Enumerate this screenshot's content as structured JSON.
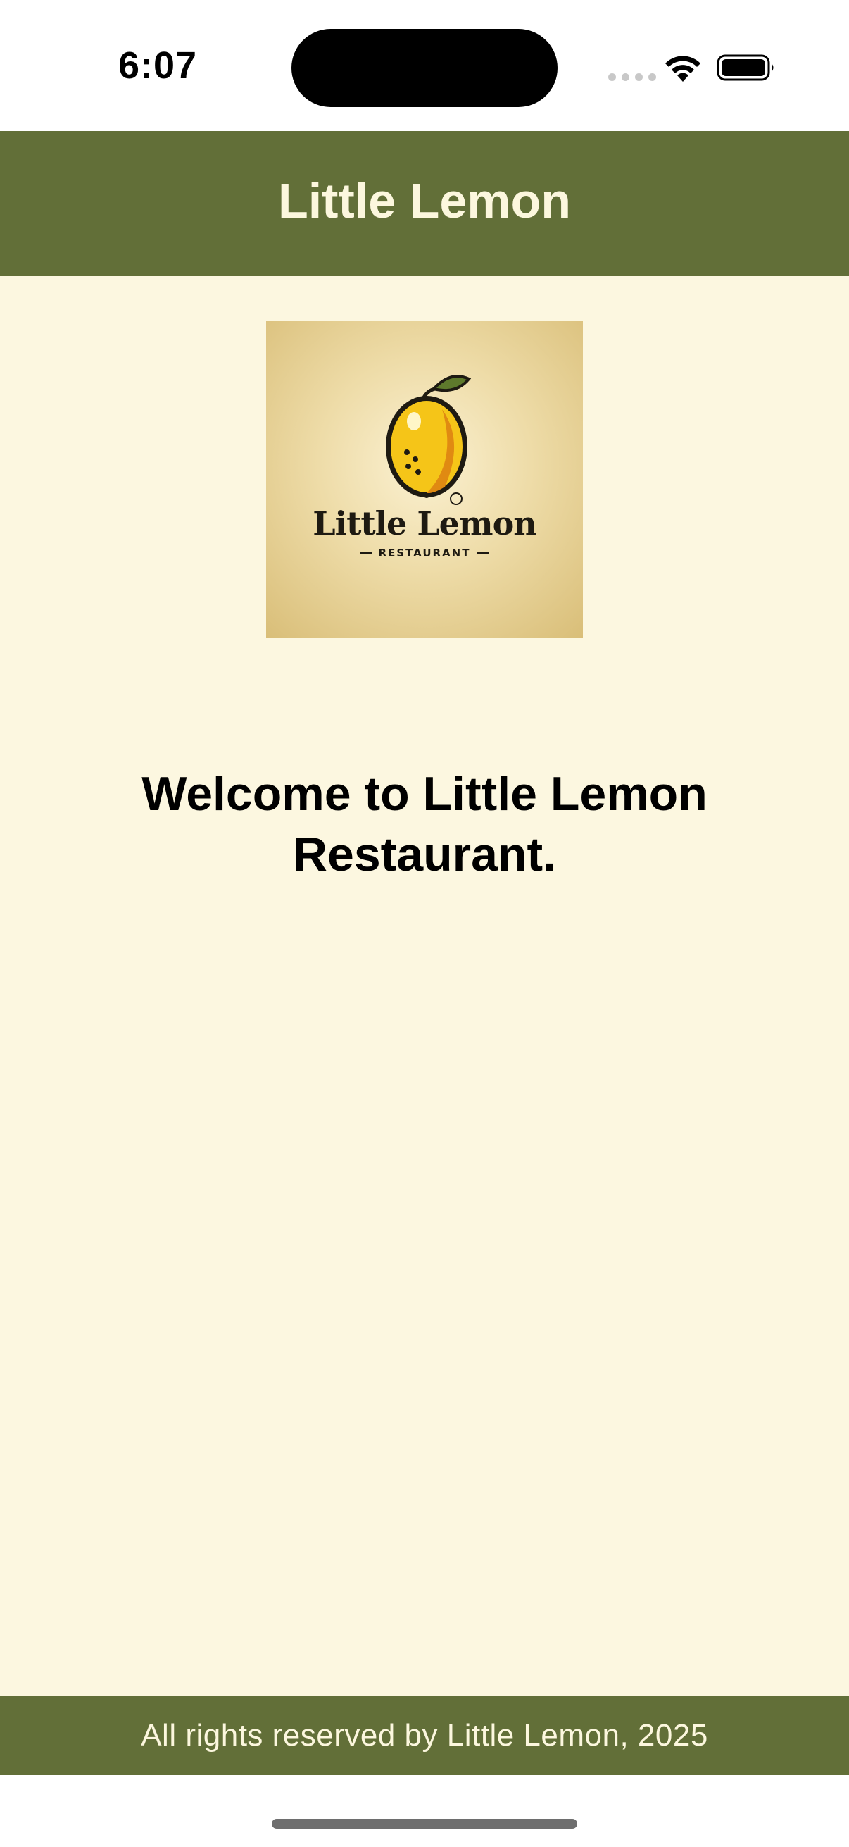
{
  "status_bar": {
    "time": "6:07",
    "icons": [
      "signal-dots-icon",
      "wifi-icon",
      "battery-icon"
    ]
  },
  "nav_bar": {
    "title": "Little Lemon"
  },
  "logo": {
    "brand_name": "Little Lemon",
    "subtitle": "RESTAURANT"
  },
  "welcome": {
    "message": "Welcome to Little Lemon Restaurant."
  },
  "footer": {
    "text": "All rights reserved by Little Lemon, 2025"
  },
  "colors": {
    "primary_green": "#626F38",
    "background_cream": "#FCF7E0",
    "header_text": "#FCF7DE",
    "lemon_yellow": "#F5C518"
  }
}
